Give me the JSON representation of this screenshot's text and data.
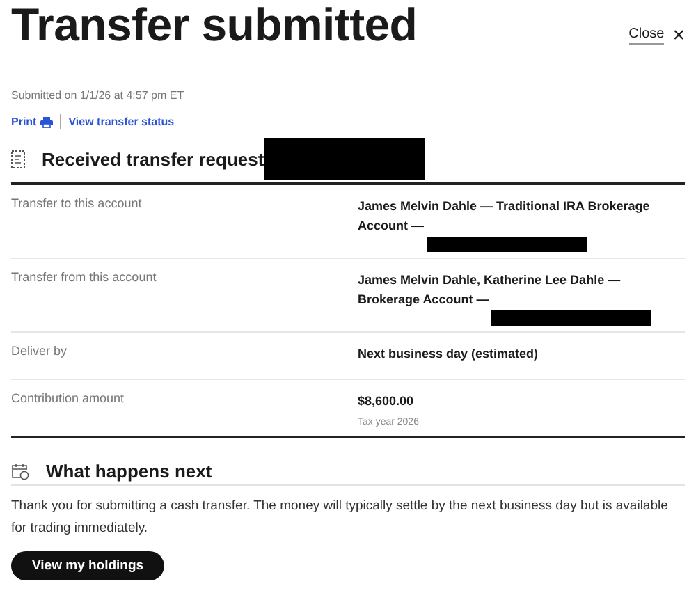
{
  "title": "Transfer submitted",
  "close": {
    "label": "Close",
    "icon": "×"
  },
  "submitted": "Submitted on 1/1/26 at 4:57 pm ET",
  "links": [
    {
      "label": "Print",
      "kind": "print"
    },
    {
      "label": "View transfer status",
      "kind": "plain"
    }
  ],
  "request": {
    "heading": "Received transfer request",
    "redacted": true,
    "rows": [
      {
        "label": "Transfer to this account",
        "value": "James Melvin Dahle — Traditional IRA Brokerage Account —",
        "redacted": true
      },
      {
        "label": "Transfer from this account",
        "value": "James Melvin Dahle, Katherine Lee Dahle — Brokerage Account —",
        "redacted": true
      },
      {
        "label": "Deliver by",
        "value": "Next business day (estimated)",
        "redacted": false
      },
      {
        "label": "Contribution amount",
        "value": "$8,600.00",
        "note": "Tax year 2026",
        "redacted": false
      }
    ]
  },
  "next": {
    "heading": "What happens next",
    "text": "Thank you for submitting a cash transfer. The money will typically settle by the next business day but is available for trading immediately.",
    "button": "View my holdings"
  }
}
